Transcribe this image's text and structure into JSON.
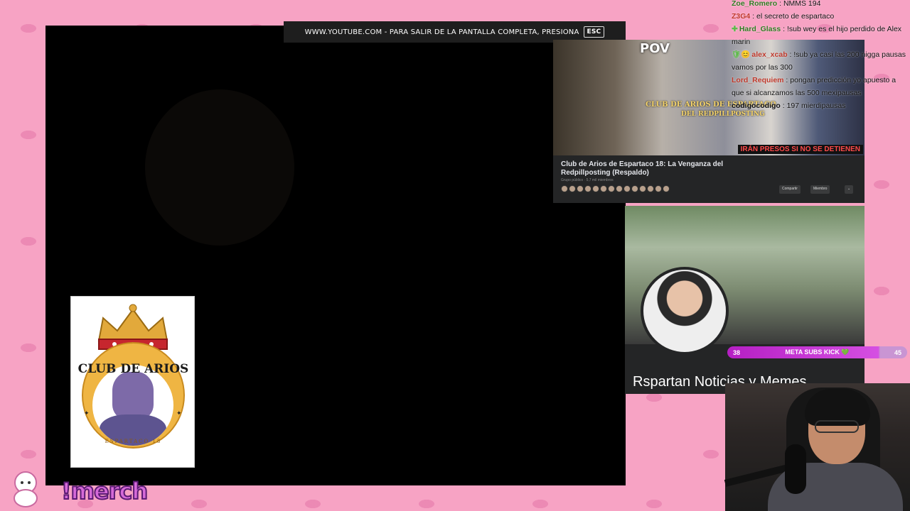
{
  "fullscreen_notice": {
    "text": "WWW.YOUTUBE.COM - PARA SALIR DE LA PANTALLA COMPLETA, PRESIONA",
    "key": "ESC"
  },
  "video_card": {
    "thumb_pov": "POV",
    "thumb_overlay_1": "CLUB DE ARIOS DE ESPARTACO",
    "thumb_overlay_2": "DEL REDPILLPOSTING",
    "thumb_warning": "IRÁN PRESOS SI NO SE DETIENEN",
    "title": "Club de Arios de Espartaco 18: La Venganza del Redpillposting (Respaldo)",
    "meta": "Grupo público · 5,7 mil miembros",
    "share_label": "Compartir",
    "members_label": "Miembro",
    "more_label": "⌄"
  },
  "news_card": {
    "name": "Rspartan Noticias y Memes"
  },
  "goal_bar": {
    "current": "38",
    "label": "META SUBS KICK",
    "heart": "💚",
    "target": "45",
    "progress": 0.84
  },
  "chat": [
    {
      "user": "Zoe_Romero",
      "text": " : NMMS 194",
      "color": "#2f7d22",
      "badge": ""
    },
    {
      "user": "Z3G4",
      "text": " : el secreto de espartaco",
      "color": "#c0392b",
      "badge": ""
    },
    {
      "user": "Hard_Glass",
      "text": " : !sub wey es el hijo perdido de Alex marin",
      "color": "#2f7d22",
      "badge": "✚"
    },
    {
      "user": "alex_xcab",
      "text": " : !sub ya casi las 200 nigga pausas vamos por las 300",
      "color": "#c0392b",
      "badge": "🛡😊"
    },
    {
      "user": "Lord_Requiem",
      "text": " : pongan predicción yo apuesto a que si alcanzamos las 500 mexipausas",
      "color": "#c0392b",
      "badge": ""
    },
    {
      "user": "codigocodigo",
      "text": " : 197 mierdipausas",
      "color": "#111111",
      "badge": ""
    }
  ],
  "logo": {
    "top_text": "CLUB DE ARIOS",
    "bottom_text": "ESPARTACO 18"
  },
  "merch": {
    "text": "!merch"
  }
}
